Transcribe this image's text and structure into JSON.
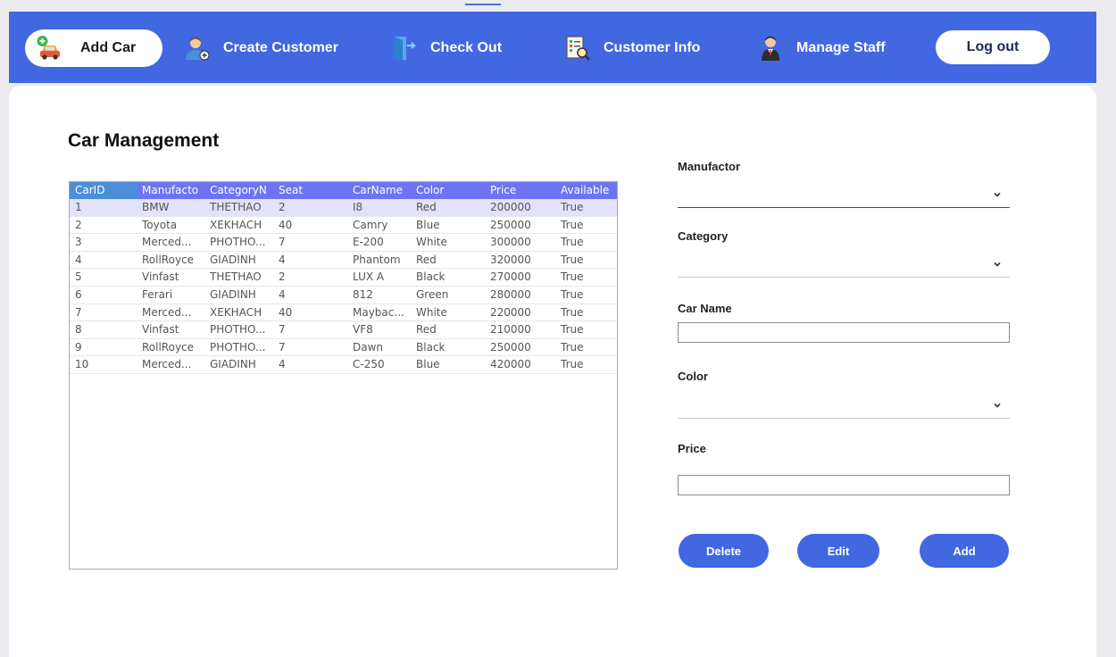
{
  "nav": {
    "add_car": "Add Car",
    "create_customer": "Create Customer",
    "check_out": "Check Out",
    "customer_info": "Customer Info",
    "manage_staff": "Manage Staff",
    "log_out": "Log out"
  },
  "page_title": "Car Management",
  "table": {
    "columns": [
      "CarID",
      "Manufacto",
      "CategoryN",
      "Seat",
      "CarName",
      "Color",
      "Price",
      "Available"
    ],
    "rows": [
      [
        "1",
        "BMW",
        "THETHAO",
        "2",
        "I8",
        "Red",
        "200000",
        "True"
      ],
      [
        "2",
        "Toyota",
        "XEKHACH",
        "40",
        "Camry",
        "Blue",
        "250000",
        "True"
      ],
      [
        "3",
        "Merced...",
        "PHOTHO...",
        "7",
        "E-200",
        "White",
        "300000",
        "True"
      ],
      [
        "4",
        "RollRoyce",
        "GIADINH",
        "4",
        "Phantom",
        "Red",
        "320000",
        "True"
      ],
      [
        "5",
        "Vinfast",
        "THETHAO",
        "2",
        "LUX A",
        "Black",
        "270000",
        "True"
      ],
      [
        "6",
        "Ferari",
        "GIADINH",
        "4",
        "812",
        "Green",
        "280000",
        "True"
      ],
      [
        "7",
        "Merced...",
        "XEKHACH",
        "40",
        "Maybac...",
        "White",
        "220000",
        "True"
      ],
      [
        "8",
        "Vinfast",
        "PHOTHO...",
        "7",
        "VF8",
        "Red",
        "210000",
        "True"
      ],
      [
        "9",
        "RollRoyce",
        "PHOTHO...",
        "7",
        "Dawn",
        "Black",
        "250000",
        "True"
      ],
      [
        "10",
        "Merced...",
        "GIADINH",
        "4",
        "C-250",
        "Blue",
        "420000",
        "True"
      ]
    ],
    "selected_row": 0
  },
  "form": {
    "manufactor_label": "Manufactor",
    "category_label": "Category",
    "car_name_label": "Car Name",
    "color_label": "Color",
    "price_label": "Price",
    "manufactor_value": "",
    "category_value": "",
    "car_name_value": "",
    "color_value": "",
    "price_value": ""
  },
  "buttons": {
    "delete": "Delete",
    "edit": "Edit",
    "add": "Add"
  },
  "colors": {
    "accent": "#4168e1",
    "table_header": "#6d74f3",
    "selected_row": "#e3e2fb"
  },
  "icons": {
    "add_car": "car-plus-icon",
    "create_customer": "user-add-icon",
    "check_out": "door-exit-icon",
    "customer_info": "document-search-icon",
    "manage_staff": "staff-icon"
  }
}
